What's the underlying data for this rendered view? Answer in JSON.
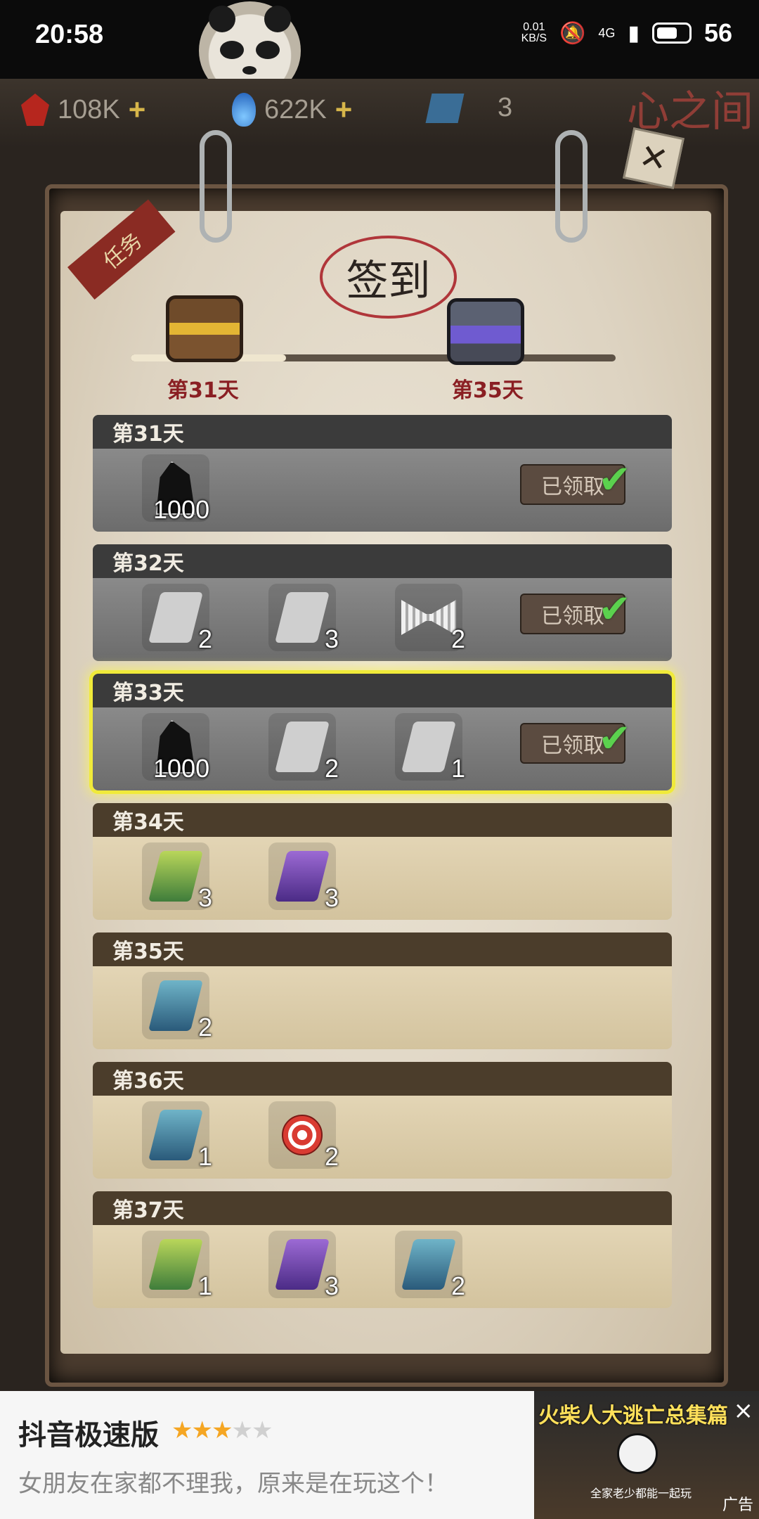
{
  "status_bar": {
    "time": "20:58",
    "net_speed_value": "0.01",
    "net_speed_unit": "KB/S",
    "network": "4G",
    "battery": "56"
  },
  "resources": {
    "gems": "108K",
    "spirit": "622K",
    "scrolls": "3",
    "plus": "+"
  },
  "header_label": "心之间",
  "task_ribbon": "任务",
  "title": "签到",
  "progress": {
    "fill_fraction": 0.32,
    "start_label": "第31天",
    "end_label": "第35天"
  },
  "days": [
    {
      "label": "第31天",
      "state": "claimed",
      "rewards": [
        {
          "icon": "black-gem-icon",
          "count": "1000"
        }
      ],
      "button": "已领取"
    },
    {
      "label": "第32天",
      "state": "claimed",
      "rewards": [
        {
          "icon": "grey-scroll-icon",
          "count": "2"
        },
        {
          "icon": "grey-scroll-icon",
          "count": "3"
        },
        {
          "icon": "bow-icon",
          "count": "2"
        }
      ],
      "button": "已领取"
    },
    {
      "label": "第33天",
      "state": "claimed-current",
      "rewards": [
        {
          "icon": "black-gem-icon",
          "count": "1000"
        },
        {
          "icon": "grey-scroll-icon",
          "count": "2"
        },
        {
          "icon": "grey-scroll-icon",
          "count": "1"
        }
      ],
      "button": "已领取"
    },
    {
      "label": "第34天",
      "state": "pending",
      "rewards": [
        {
          "icon": "green-scroll-icon",
          "count": "3"
        },
        {
          "icon": "purple-scroll-icon",
          "count": "3"
        }
      ]
    },
    {
      "label": "第35天",
      "state": "pending",
      "rewards": [
        {
          "icon": "teal-scroll-icon",
          "count": "2"
        }
      ]
    },
    {
      "label": "第36天",
      "state": "pending",
      "rewards": [
        {
          "icon": "teal-scroll-icon",
          "count": "1"
        },
        {
          "icon": "lollipop-icon",
          "count": "2"
        }
      ]
    },
    {
      "label": "第37天",
      "state": "pending",
      "rewards": [
        {
          "icon": "green-scroll-icon",
          "count": "1"
        },
        {
          "icon": "purple-scroll-icon",
          "count": "3"
        },
        {
          "icon": "teal-scroll-icon",
          "count": "2"
        }
      ]
    }
  ],
  "ad": {
    "app_name": "抖音极速版",
    "stars_filled": 3,
    "stars_total": 5,
    "description": "女朋友在家都不理我，原来是在玩这个！",
    "thumb_title": "火柴人大逃亡总集篇",
    "thumb_caption": "全家老少都能一起玩",
    "ad_label": "广告",
    "close": "×"
  }
}
